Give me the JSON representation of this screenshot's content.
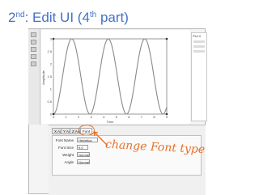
{
  "slide": {
    "title_prefix": "2",
    "title_prefix_sup": "nd",
    "title_main": ": Edit UI (4",
    "title_th": "th",
    "title_suffix": " part)",
    "annotation": "change Font type"
  },
  "plot": {
    "y_ticks": [
      "3",
      "2.5",
      "2",
      "1.5",
      "1",
      "0.5",
      "0"
    ],
    "x_ticks": [
      "0",
      "1",
      "2",
      "3",
      "4",
      "5",
      "6",
      "7",
      "8",
      "9"
    ],
    "y_label": "Amplitude",
    "x_label": "Time"
  },
  "right_panel": {
    "label": "Plot 0"
  },
  "tabs": [
    "X Axis",
    "Y Axis",
    "Z Axis",
    "Font"
  ],
  "font_panel": {
    "font_name_label": "Font Name",
    "font_name_value": "Helvetica",
    "font_size_label": "Font Size",
    "font_size_value": "9.0",
    "weight_label": "Weight",
    "weight_value": "Normal",
    "angle_label": "Angle",
    "angle_value": "Normal"
  },
  "colors": {
    "title": "#4472c4",
    "annotation": "#e8712a",
    "curve": "#8a8a8a"
  }
}
